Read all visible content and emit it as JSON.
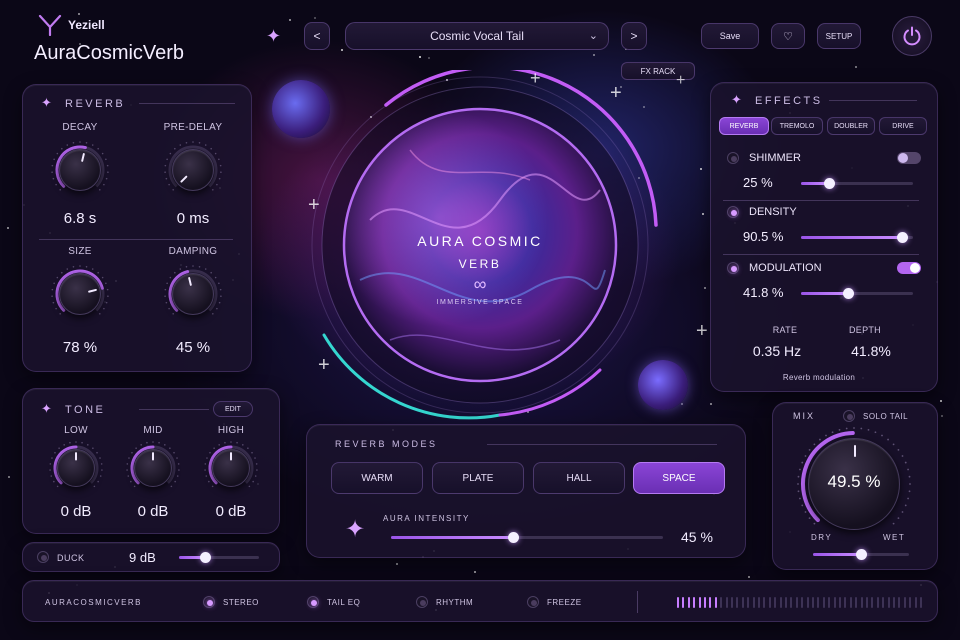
{
  "brand": {
    "company": "Yeziell",
    "product": "AuraCosmicVerb"
  },
  "header": {
    "preset_name": "Cosmic Vocal Tail",
    "prev_label": "<",
    "next_label": ">",
    "save_label": "Save",
    "setup_label": "SETUP",
    "fx_rack_label": "FX RACK"
  },
  "reverb": {
    "title": "REVERB",
    "knobs": [
      {
        "label": "DECAY",
        "value": "6.8 s",
        "level": 0.55
      },
      {
        "label": "PRE-DELAY",
        "value": "0 ms",
        "level": 0.0
      },
      {
        "label": "SIZE",
        "value": "78 %",
        "level": 0.78
      },
      {
        "label": "DAMPING",
        "value": "45 %",
        "level": 0.45
      }
    ]
  },
  "tone": {
    "title": "TONE",
    "edit_label": "EDIT",
    "knobs": [
      {
        "label": "LOW",
        "value": "0 dB",
        "level": 0.5
      },
      {
        "label": "MID",
        "value": "0 dB",
        "level": 0.5
      },
      {
        "label": "HIGH",
        "value": "0 dB",
        "level": 0.5
      }
    ]
  },
  "duck": {
    "label": "DUCK",
    "value": "9 dB",
    "level": 0.32
  },
  "orb": {
    "line1": "AURA COSMIC",
    "line2": "VERB",
    "symbol": "∞",
    "tagline": "IMMERSIVE SPACE"
  },
  "effects": {
    "title": "EFFECTS",
    "tabs": [
      "REVERB",
      "TREMOLO",
      "DOUBLER",
      "DRIVE"
    ],
    "active_tab": 0,
    "rows": [
      {
        "label": "SHIMMER",
        "value": "25 %",
        "level": 0.25,
        "enabled": false
      },
      {
        "label": "DENSITY",
        "value": "90.5 %",
        "level": 0.905,
        "enabled": true
      },
      {
        "label": "MODULATION",
        "value": "41.8 %",
        "level": 0.418,
        "enabled": true
      }
    ],
    "rate_label": "RATE",
    "rate_value": "0.35 Hz",
    "depth_label": "DEPTH",
    "depth_value": "41.8%",
    "footer": "Reverb modulation"
  },
  "modes": {
    "title": "REVERB MODES",
    "buttons": [
      "WARM",
      "PLATE",
      "HALL",
      "SPACE"
    ],
    "active": 3,
    "intensity_label": "AURA INTENSITY",
    "intensity_value": "45 %",
    "intensity_level": 0.45
  },
  "mix": {
    "title": "MIX",
    "solo_label": "SOLO TAIL",
    "value": "49.5 %",
    "level": 0.495,
    "dry_label": "DRY",
    "wet_label": "WET",
    "balance": 0.5
  },
  "footer": {
    "name": "AURACOSMICVERB",
    "toggles": [
      {
        "label": "STEREO",
        "on": true
      },
      {
        "label": "TAIL EQ",
        "on": true
      },
      {
        "label": "RHYTHM",
        "on": false
      },
      {
        "label": "FREEZE",
        "on": false
      }
    ],
    "meter_level": 0.18
  },
  "colors": {
    "accent": "#b566f0",
    "accent_light": "#d79bff",
    "panel": "#1a122c",
    "teal": "#35d6d0"
  },
  "icons": {
    "logo": "y-logo-icon",
    "sparkle": "sparkle-icon",
    "favorite": "heart-icon",
    "power": "power-icon",
    "dropdown": "chevron-down-icon"
  }
}
